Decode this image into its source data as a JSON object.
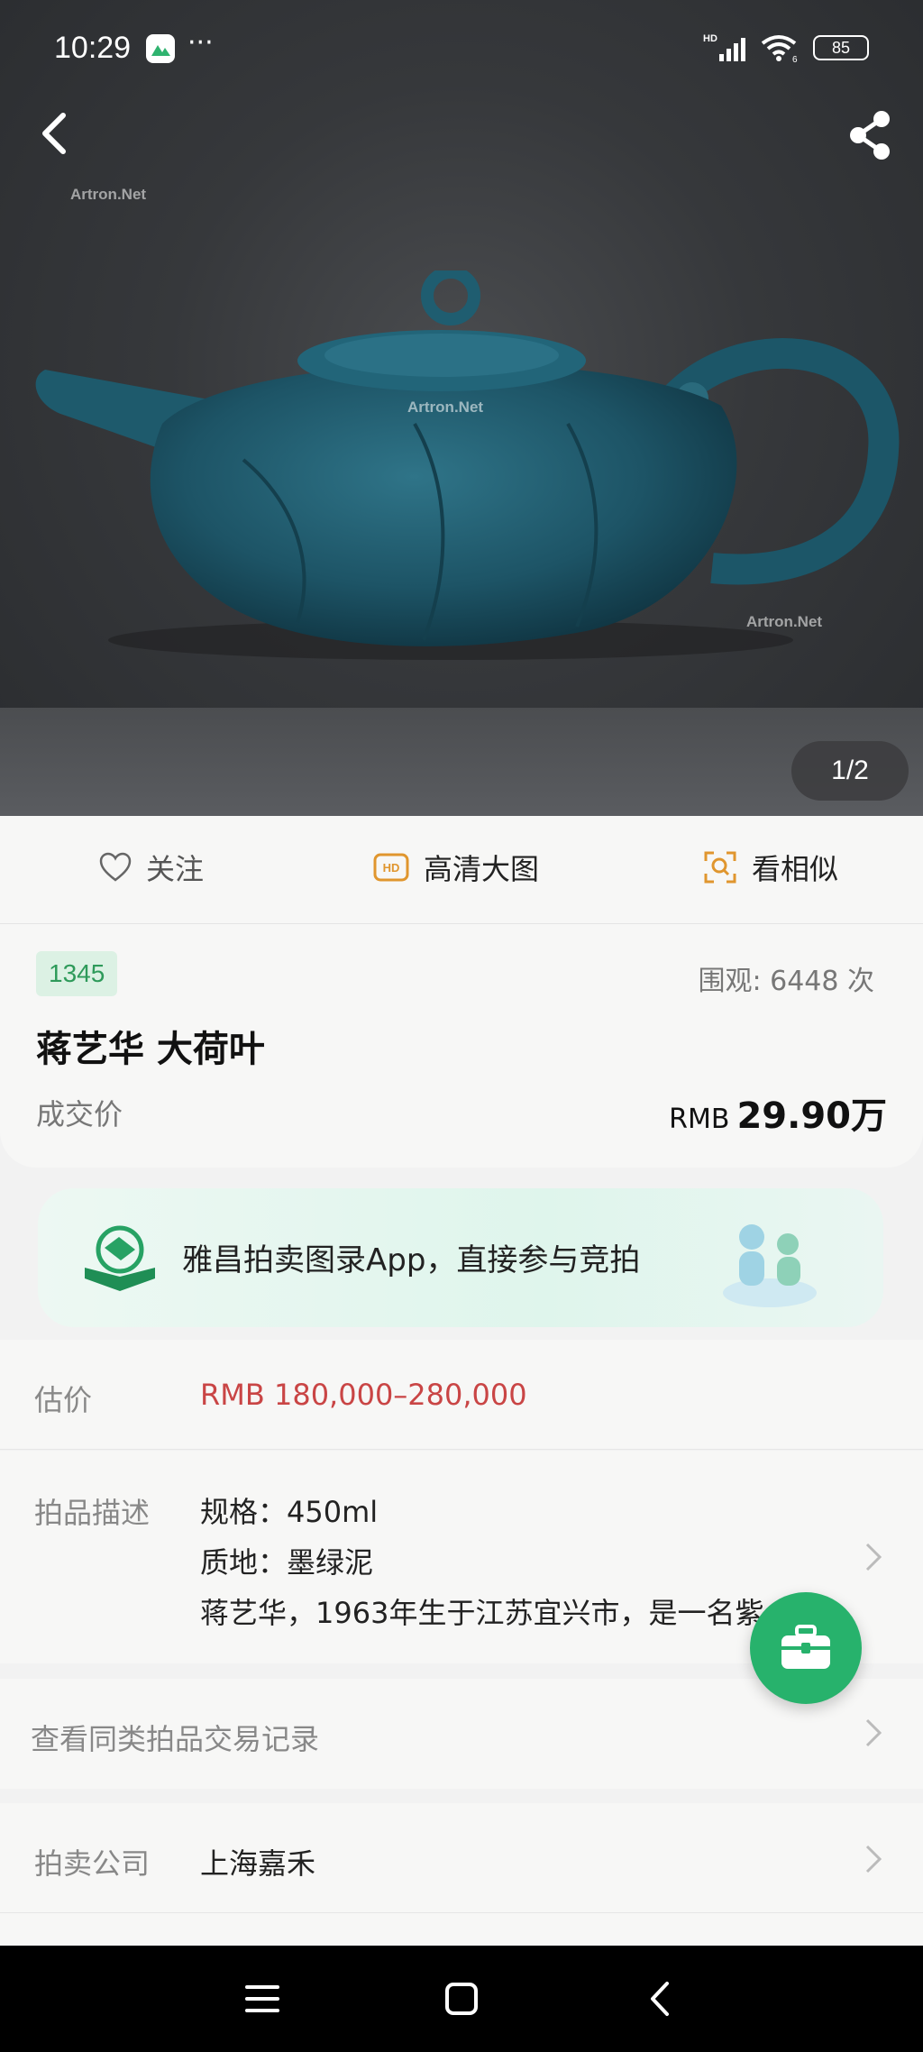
{
  "status_bar": {
    "time": "10:29",
    "dots": "···",
    "network": "HD",
    "wifi_badge": "6",
    "battery": "85"
  },
  "hero": {
    "watermark": "Artron.Net",
    "image_counter": "1/2"
  },
  "actions": {
    "follow": "关注",
    "hd": "高清大图",
    "hd_badge": "HD",
    "similar": "看相似"
  },
  "lot": {
    "number": "1345",
    "views": "围观:  6448  次",
    "title": "蒋艺华 大荷叶",
    "price_label": "成交价",
    "price_currency": "RMB",
    "price_value": "29.90万"
  },
  "banner": {
    "text": "雅昌拍卖图录App，直接参与竞拍"
  },
  "details": {
    "estimate_label": "估价",
    "estimate_value": "RMB  180,000–280,000",
    "desc_label": "拍品描述",
    "desc_line1": "规格：450ml",
    "desc_line2": "质地：墨绿泥",
    "desc_line3": "蒋艺华，1963年生于江苏宜兴市，是一名紫",
    "records_label": "查看同类拍品交易记录",
    "company_label": "拍卖公司",
    "company_value": "上海嘉禾"
  },
  "colors": {
    "accent_green": "#27b26c",
    "estimate_red": "#c94545",
    "hd_orange": "#e0962e"
  }
}
